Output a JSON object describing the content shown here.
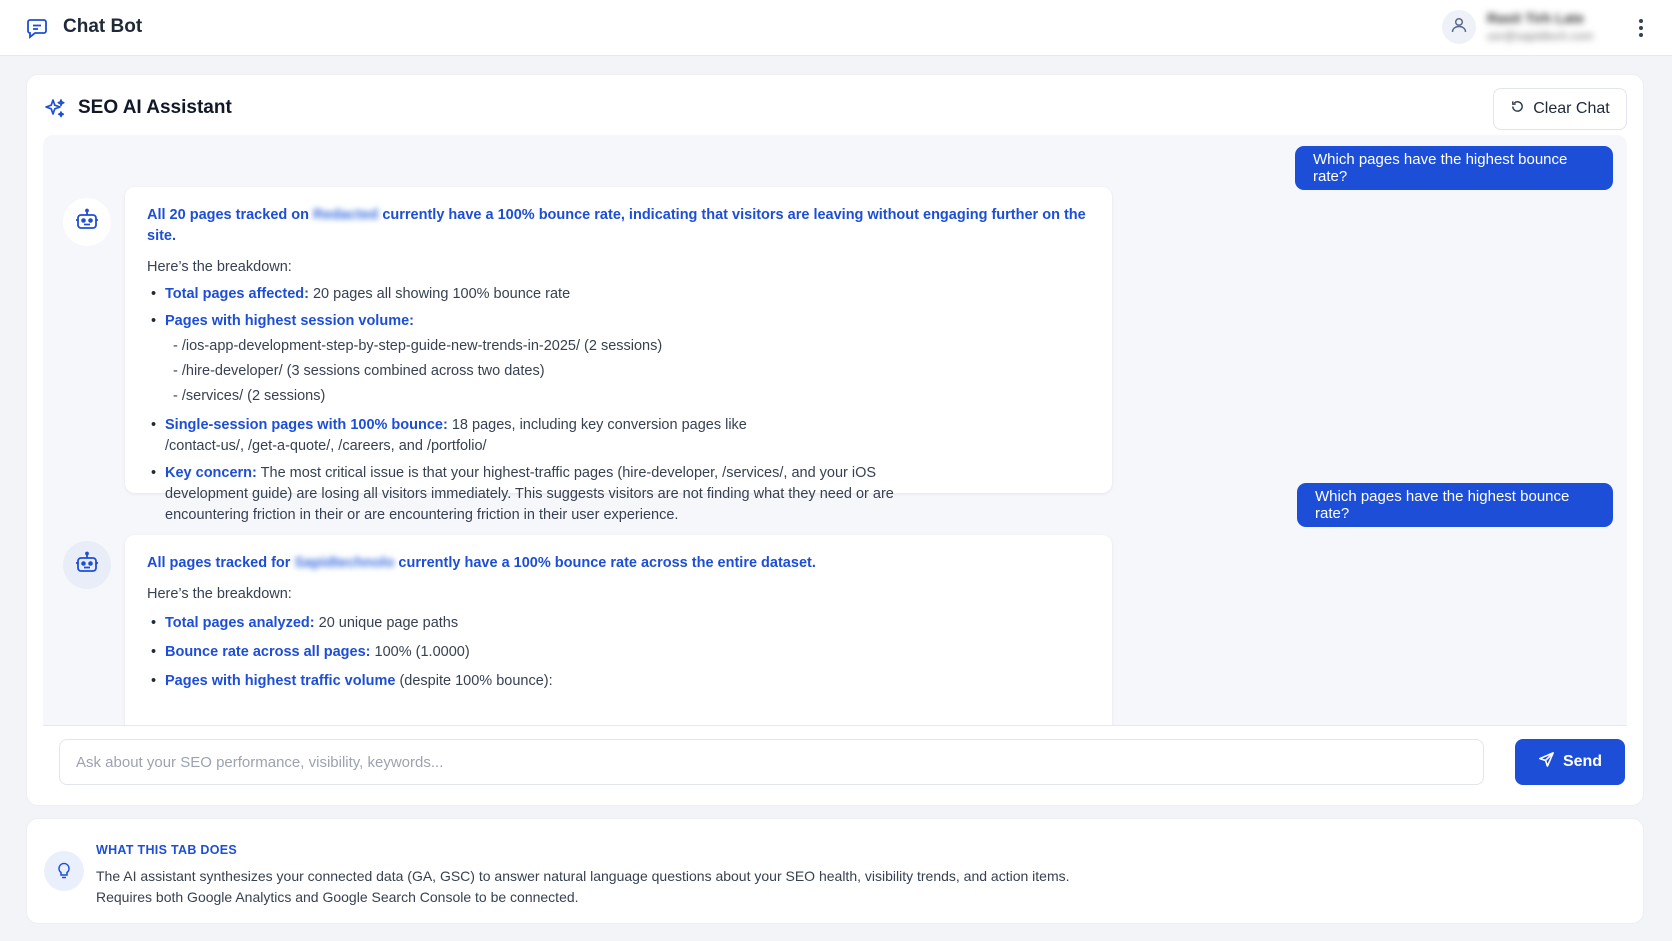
{
  "app": {
    "title": "Chat Bot",
    "user_name": "Rasit Tirh Late",
    "user_email": "usr@sapidtech.com"
  },
  "assistant": {
    "title": "SEO AI Assistant",
    "clear_label": "Clear Chat"
  },
  "messages": {
    "user1": "Which pages have the highest bounce rate?",
    "bot1": {
      "lead_pre": "All 20 pages tracked on",
      "lead_blur": "Redacted",
      "lead_post": "currently have a 100% bounce rate, indicating that visitors are leaving without engaging further on the site.",
      "intro": "Here’s the breakdown:",
      "b1_key": "Total pages affected:",
      "b1_val": " 20 pages all showing 100% bounce rate",
      "b2_key": "Pages with highest session volume:",
      "sub1": "- /ios-app-development-step-by-step-guide-new-trends-in-2025/ (2 sessions)",
      "sub2": "- /hire-developer/ (3 sessions combined across two dates)",
      "sub3": "- /services/ (2 sessions)",
      "b3_key": "Single-session pages with 100% bounce:",
      "b3_val": " 18 pages, including key conversion pages like /contact-us/, /get-a-quote/, /careers, and /portfolio/",
      "b4_key": "Key concern:",
      "b4_val": " The most critical issue is that your highest-traffic pages (hire-developer, /services/, and your iOS development guide) are losing all visitors immediately. This suggests visitors are not finding what they need or are encountering friction in their or are encountering friction in their user experience."
    },
    "user2": "Which pages have the highest bounce rate?",
    "bot2": {
      "lead_pre": "All pages tracked for",
      "lead_blur": "Sapidtechnolo",
      "lead_post": "currently have a 100% bounce rate across the entire dataset.",
      "intro": "Here’s the breakdown:",
      "b1_key": "Total pages analyzed:",
      "b1_val": " 20 unique page paths",
      "b2_key": "Bounce rate across all pages:",
      "b2_val": " 100% (1.0000)",
      "b3_key": "Pages with highest traffic volume",
      "b3_val": " (despite 100% bounce):"
    }
  },
  "composer": {
    "placeholder": "Ask about your SEO performance, visibility, keywords...",
    "send_label": "Send"
  },
  "info": {
    "heading": "WHAT THIS TAB DOES",
    "line1": "The AI assistant synthesizes your connected data (GA, GSC) to answer natural language questions about your SEO health, visibility trends, and action items.",
    "line2": "Requires both Google Analytics and Google Search Console to be connected."
  },
  "colors": {
    "accent": "#1d4ed8",
    "background": "#f3f4f7",
    "chat_background": "#f6f7fb"
  },
  "icons": [
    "chat-bubble-icon",
    "user-icon",
    "kebab-menu-icon",
    "sparkles-icon",
    "refresh-icon",
    "robot-icon",
    "send-icon",
    "lightbulb-icon"
  ]
}
